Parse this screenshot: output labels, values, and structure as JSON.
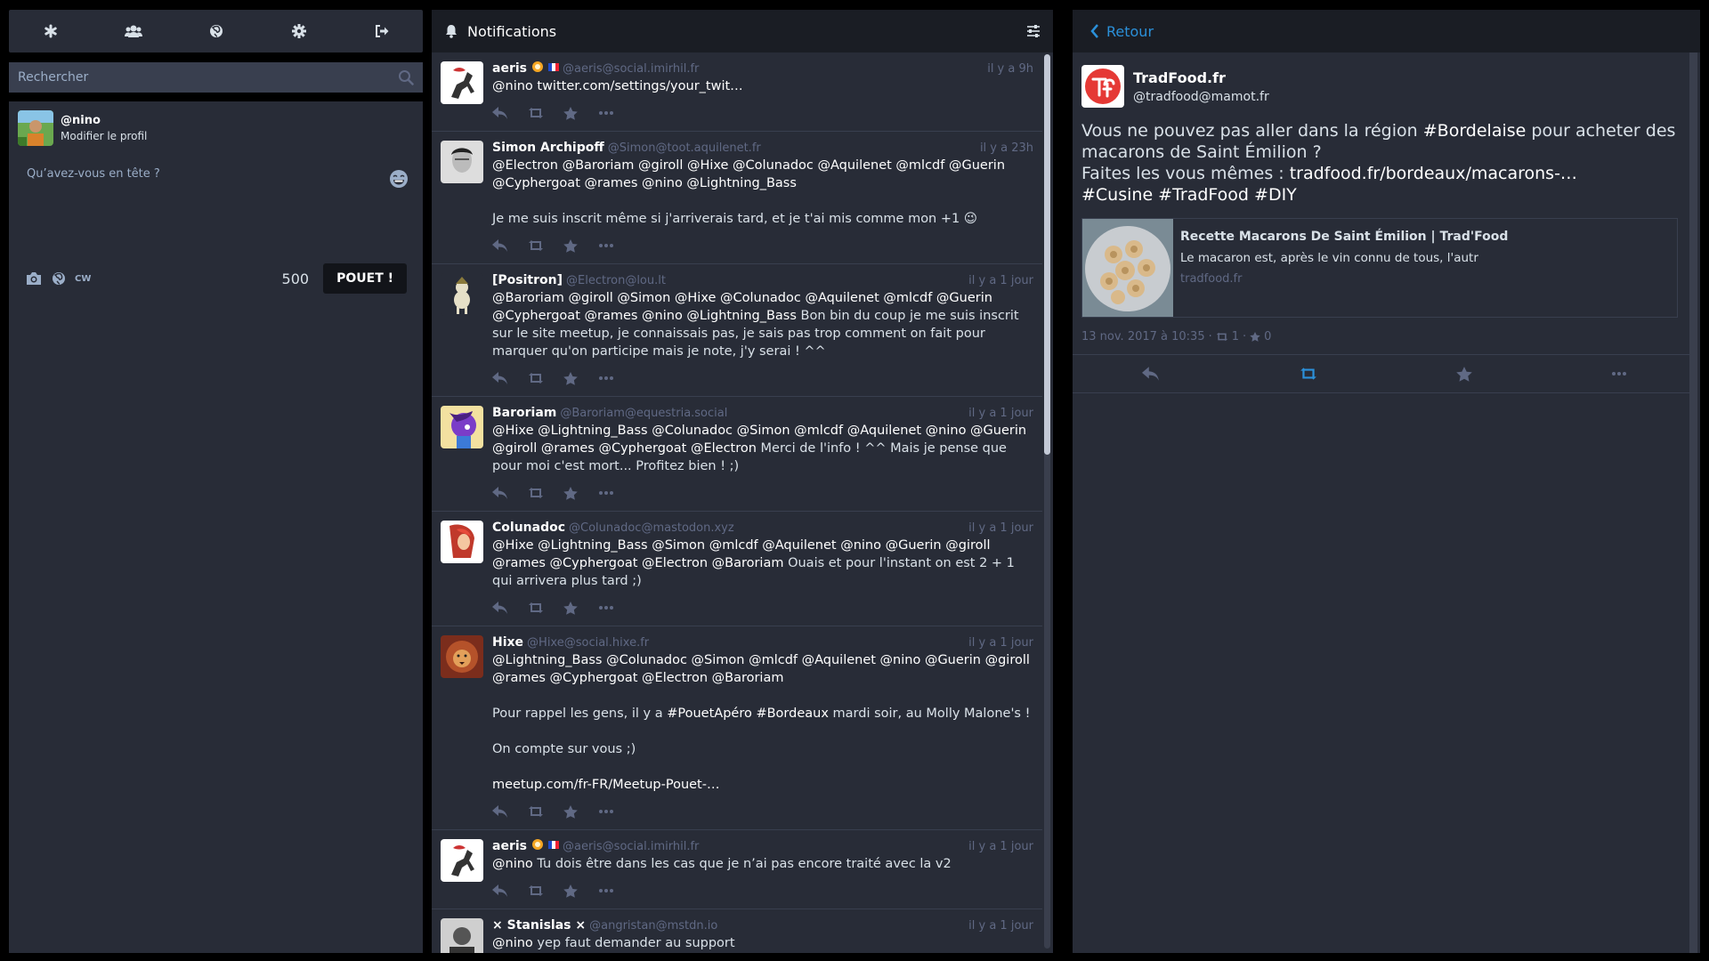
{
  "colors": {
    "background": "#000000",
    "panel": "#282c37",
    "header": "#1a1d24",
    "accent": "#2b90d9",
    "muted": "#606984",
    "text": "#d9e1e8",
    "icon": "#9baec8"
  },
  "nav": {
    "items": [
      {
        "icon": "asterisk-icon",
        "label": "Getting started"
      },
      {
        "icon": "users-icon",
        "label": "Local timeline"
      },
      {
        "icon": "globe-icon",
        "label": "Federated timeline"
      },
      {
        "icon": "gear-icon",
        "label": "Preferences"
      },
      {
        "icon": "sign-out-icon",
        "label": "Logout"
      }
    ]
  },
  "search": {
    "placeholder": "Rechercher"
  },
  "profile": {
    "handle": "@nino",
    "edit_label": "Modifier le profil"
  },
  "compose": {
    "placeholder": "Qu’avez-vous en tête ?",
    "cw_label": "CW",
    "char_count": "500",
    "submit_label": "POUET !"
  },
  "notifications": {
    "title": "Notifications",
    "statuses": [
      {
        "name": "aeris",
        "acct": "@aeris@social.imirhil.fr",
        "time": "il y a 9h",
        "paragraphs": [
          "@nino twitter.com/settings/your_twit…"
        ]
      },
      {
        "name": "Simon Archipoff",
        "acct": "@Simon@toot.aquilenet.fr",
        "time": "il y a 23h",
        "paragraphs": [
          "@Electron @Baroriam @giroll @Hixe @Colunadoc @Aquilenet @mlcdf @Guerin @Cyphergoat @rames @nino @Lightning_Bass",
          "Je me suis inscrit même si j'arriverais tard, et je t'ai mis comme mon +1 😉"
        ]
      },
      {
        "name": "[Positron]",
        "acct": "@Electron@lou.lt",
        "time": "il y a 1 jour",
        "mentions": "@Baroriam @giroll @Simon @Hixe @Colunadoc @Aquilenet @mlcdf @Guerin @Cyphergoat @rames @nino @Lightning_Bass",
        "text": " Bon bin du coup je me suis inscrit sur le site meetup, je connaissais pas, je sais pas trop comment on fait pour marquer qu'on participe mais je note, j'y serai ! ^^"
      },
      {
        "name": "Baroriam",
        "acct": "@Baroriam@equestria.social",
        "time": "il y a 1 jour",
        "mentions": "@Hixe @Lightning_Bass @Colunadoc @Simon @mlcdf @Aquilenet @nino @Guerin @giroll @rames @Cyphergoat @Electron",
        "text": " Merci de l'info ! ^^ Mais je pense que pour moi c'est mort... Profitez bien ! ;)"
      },
      {
        "name": "Colunadoc",
        "acct": "@Colunadoc@mastodon.xyz",
        "time": "il y a 1 jour",
        "mentions": "@Hixe @Lightning_Bass @Simon @mlcdf @Aquilenet @nino @Guerin @giroll @rames @Cyphergoat @Electron @Baroriam",
        "text": " Ouais et pour l'instant on est 2 + 1 qui arrivera plus tard ;)"
      },
      {
        "name": "Hixe",
        "acct": "@Hixe@social.hixe.fr",
        "time": "il y a 1 jour",
        "mentions": "@Lightning_Bass @Colunadoc @Simon @mlcdf @Aquilenet @nino @Guerin @giroll @rames @Cyphergoat @Electron @Baroriam",
        "p2_before": "Pour rappel les gens, il y a ",
        "p2_tag1": "#PouetApéro",
        "p2_space": " ",
        "p2_tag2": "#Bordeaux",
        "p2_after": " mardi soir, au Molly Malone's !",
        "p3": "On compte sur vous ;)",
        "p4": "meetup.com/fr-FR/Meetup-Pouet-…"
      },
      {
        "name": "aeris",
        "acct": "@aeris@social.imirhil.fr",
        "time": "il y a 1 jour",
        "mentions": "@nino",
        "text": " Tu dois être dans les cas que je n’ai pas encore traité avec la v2"
      },
      {
        "name": "× Stanislas ×",
        "acct": "@angristan@mstdn.io",
        "time": "il y a 1 jour",
        "mentions": "@nino",
        "text": " yep faut demander au support"
      }
    ]
  },
  "detail": {
    "back_label": "Retour",
    "name": "TradFood.fr",
    "acct": "@tradfood@mamot.fr",
    "content": {
      "l1_before": "Vous ne pouvez pas aller dans la région ",
      "l1_tag": "#Bordelaise",
      "l1_after": " pour acheter des macarons de Saint Émilion ?",
      "l2_before": "Faites les vous mêmes : ",
      "l2_link": "tradfood.fr/bordeaux/macarons-…",
      "l3": "#Cusine #TradFood #DIY"
    },
    "card": {
      "title": "Recette Macarons De Saint Émilion | Trad'Food",
      "description": "Le macaron est, après le vin connu de tous, l'autr",
      "host": "tradfood.fr"
    },
    "date": "13 nov. 2017 à 10:35",
    "separator": "·",
    "boosts": "1",
    "favourites": "0"
  }
}
